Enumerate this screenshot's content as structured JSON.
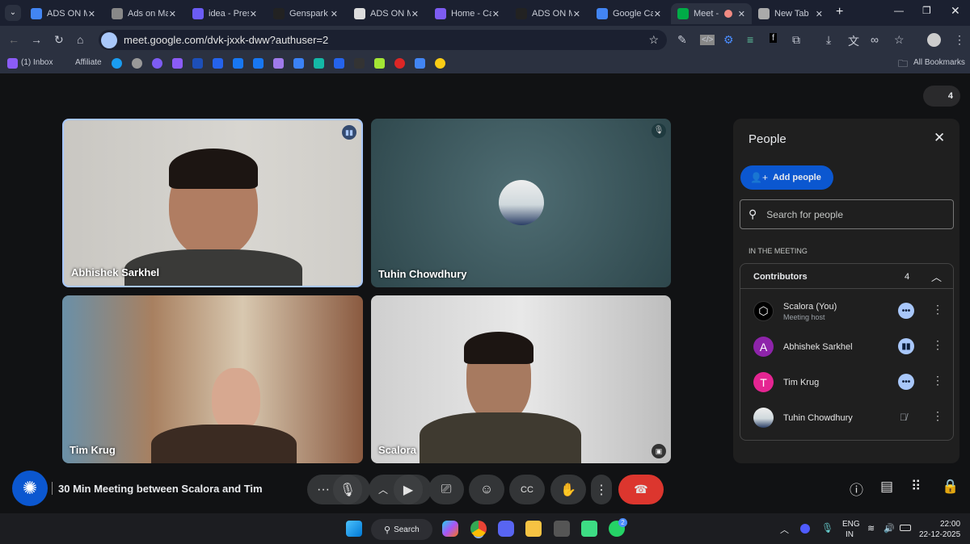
{
  "browser": {
    "tabs": [
      {
        "label": "ADS ON M",
        "icon": "docs-icon",
        "color": "#4285f4"
      },
      {
        "label": "Ads on Ma",
        "icon": "chatgpt-icon",
        "color": "#888"
      },
      {
        "label": "idea - Pres",
        "icon": "pitch-icon",
        "color": "#6b5cf6"
      },
      {
        "label": "Genspark",
        "icon": "genspark-icon",
        "color": "#222"
      },
      {
        "label": "ADS ON M",
        "icon": "g-icon",
        "color": "#ddd"
      },
      {
        "label": "Home - Ca",
        "icon": "canva-icon",
        "color": "#7d5cf2"
      },
      {
        "label": "ADS ON M",
        "icon": "genspark-icon",
        "color": "#222"
      },
      {
        "label": "Google Ca",
        "icon": "calendar-icon",
        "color": "#4285f4"
      },
      {
        "label": "Meet -",
        "icon": "meet-icon",
        "color": "#00ac47"
      },
      {
        "label": "New Tab",
        "icon": "chrome-icon",
        "color": "#aaa"
      }
    ],
    "url": "meet.google.com/dvk-jxxk-dww?authuser=2",
    "bookmarks": {
      "inbox": "(1) Inbox",
      "affiliate": "Affiliate",
      "all": "All Bookmarks"
    }
  },
  "meet": {
    "participant_count": "4",
    "tiles": [
      {
        "name": "Abhishek Sarkhel",
        "status": "speaking"
      },
      {
        "name": "Tuhin Chowdhury",
        "status": "muted"
      },
      {
        "name": "Tim Krug",
        "status": ""
      },
      {
        "name": "Scalora",
        "status": ""
      }
    ],
    "meeting_title": "30 Min Meeting between Scalora and Tim",
    "people": {
      "title": "People",
      "add_people": "Add people",
      "search_placeholder": "Search for people",
      "section": "IN THE MEETING",
      "group": "Contributors",
      "group_count": "4",
      "list": [
        {
          "name": "Scalora (You)",
          "sub": "Meeting host",
          "initial": "",
          "color": "#000"
        },
        {
          "name": "Abhishek Sarkhel",
          "sub": "",
          "initial": "A",
          "color": "#8e24aa"
        },
        {
          "name": "Tim Krug",
          "sub": "",
          "initial": "T",
          "color": "#e52592"
        },
        {
          "name": "Tuhin Chowdhury",
          "sub": "",
          "initial": "",
          "color": "#cfd8dc"
        }
      ]
    }
  },
  "taskbar": {
    "search": "Search",
    "lang1": "ENG",
    "lang2": "IN",
    "time": "22:00",
    "date": "22-12-2025",
    "whatsapp_badge": "2"
  }
}
